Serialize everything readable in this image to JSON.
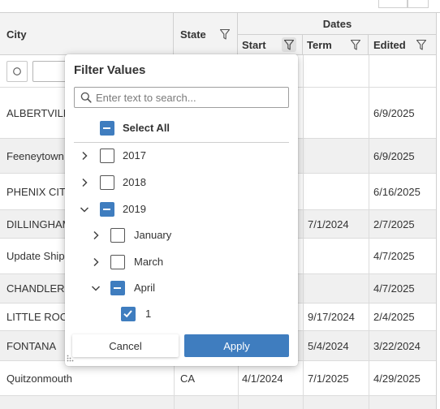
{
  "columns": {
    "city": "City",
    "state": "State",
    "dates_group": "Dates",
    "start": "Start",
    "term": "Term",
    "edited": "Edited"
  },
  "rows": [
    {
      "city": "ALBERTVILLE",
      "state": "",
      "start": "",
      "term": "",
      "edited": "6/9/2025"
    },
    {
      "city": "Feeneytown",
      "state": "",
      "start": "",
      "term": "",
      "edited": "6/9/2025"
    },
    {
      "city": "PHENIX CITY",
      "state": "",
      "start": "",
      "term": "",
      "edited": "6/16/2025"
    },
    {
      "city": "DILLINGHAM",
      "state": "",
      "start": "",
      "term": "7/1/2024",
      "edited": "2/7/2025"
    },
    {
      "city": "Update Shipping",
      "state": "",
      "start": "",
      "term": "",
      "edited": "4/7/2025"
    },
    {
      "city": "CHANDLER",
      "state": "",
      "start": "",
      "term": "",
      "edited": "4/7/2025"
    },
    {
      "city": "LITTLE ROCK",
      "state": "",
      "start": "",
      "term": "9/17/2024",
      "edited": "2/4/2025"
    },
    {
      "city": "FONTANA",
      "state": "",
      "start": "",
      "term": "5/4/2024",
      "edited": "3/22/2024"
    },
    {
      "city": "Quitzonmouth",
      "state": "CA",
      "start": "4/1/2024",
      "term": "7/1/2025",
      "edited": "4/29/2025"
    }
  ],
  "filter_popup": {
    "title": "Filter Values",
    "search_placeholder": "Enter text to search...",
    "select_all": "Select All",
    "tree": [
      {
        "label": "2017",
        "state": "unchecked",
        "expanded": false
      },
      {
        "label": "2018",
        "state": "unchecked",
        "expanded": false
      },
      {
        "label": "2019",
        "state": "partial",
        "expanded": true
      },
      {
        "label": "January",
        "state": "unchecked",
        "expanded": false
      },
      {
        "label": "March",
        "state": "unchecked",
        "expanded": false
      },
      {
        "label": "April",
        "state": "partial",
        "expanded": true
      },
      {
        "label": "1",
        "state": "checked"
      }
    ],
    "cancel_label": "Cancel",
    "apply_label": "Apply"
  },
  "colors": {
    "accent": "#3f7dbf",
    "header_bg": "#f3f3f3",
    "alt_row_bg": "#f0f0f0"
  }
}
